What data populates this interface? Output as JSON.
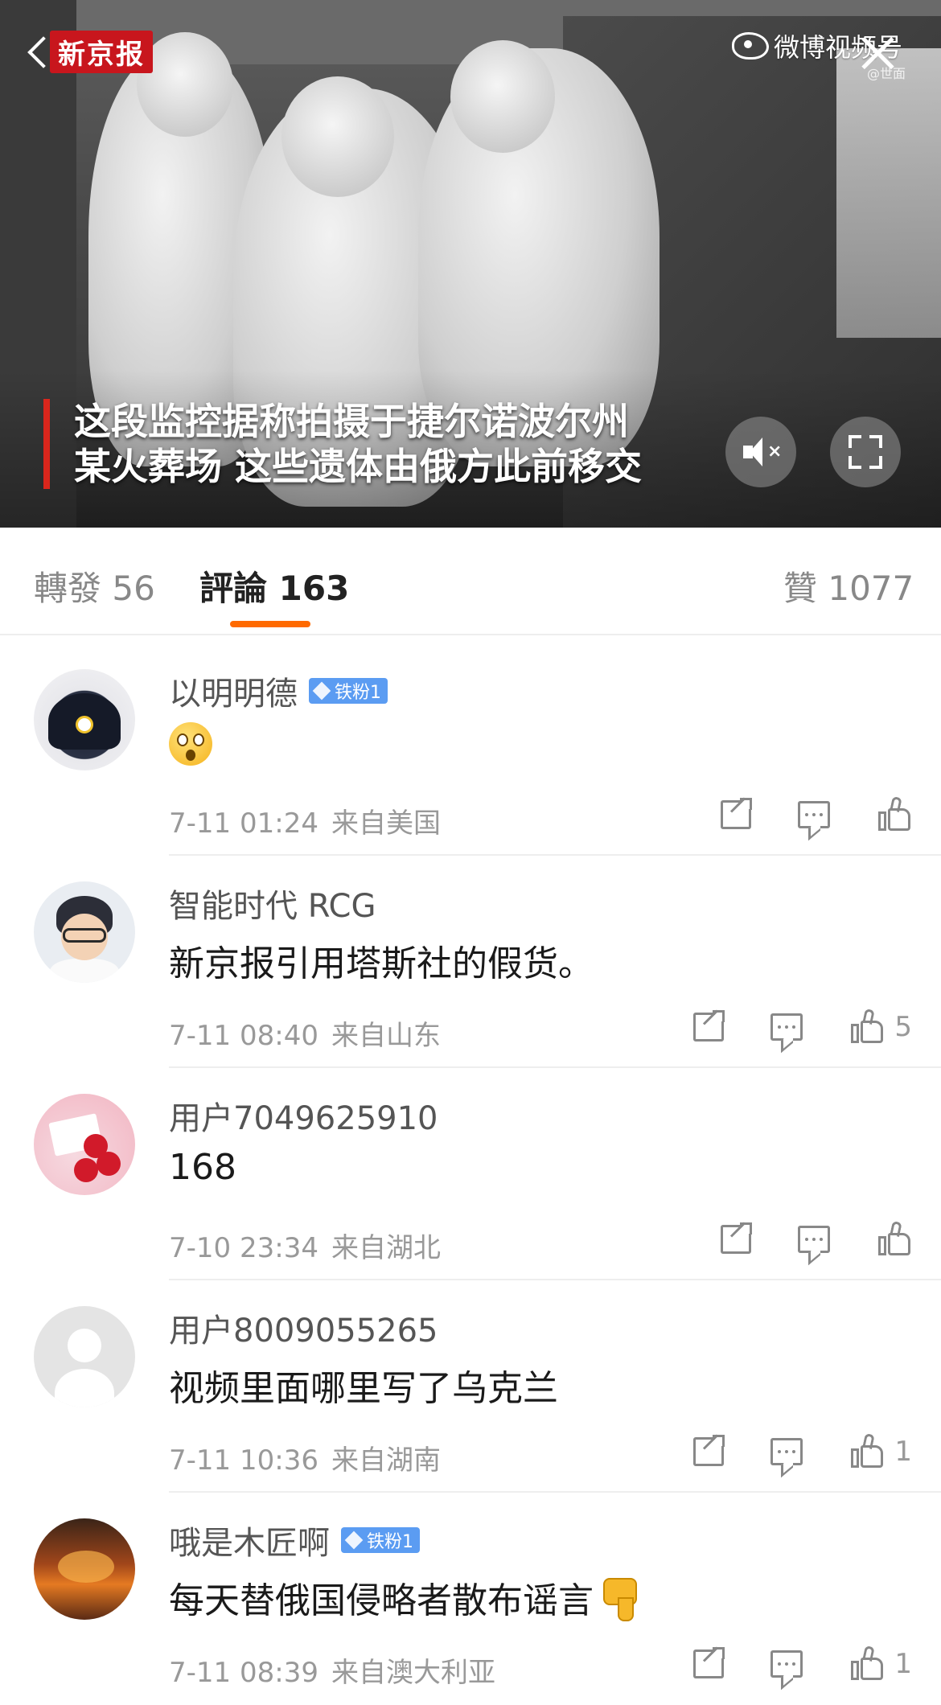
{
  "video": {
    "logo_text": "新京报",
    "platform_text": "微博视频号",
    "watermark_small": "@世面",
    "caption_line1": "这段监控据称拍摄于捷尔诺波尔州",
    "caption_line2": "某火葬场 这些遗体由俄方此前移交",
    "accent_color": "#d9261c"
  },
  "tabs": {
    "repost": "轉發 56",
    "comment": "評論 163",
    "like": "贊 1077",
    "active": "comment",
    "underline_color": "#ff6a00"
  },
  "comments": [
    {
      "username": "以明明德",
      "badge": "铁粉1",
      "text": "",
      "emoji": "astonished-face",
      "time": "7-11 01:24",
      "location": "来自美国",
      "likes": ""
    },
    {
      "username": "智能时代 RCG",
      "badge": "",
      "text": "新京报引用塔斯社的假货。",
      "time": "7-11 08:40",
      "location": "来自山东",
      "likes": "5"
    },
    {
      "username": "用户7049625910",
      "badge": "",
      "text": "168",
      "time": "7-10 23:34",
      "location": "来自湖北",
      "likes": ""
    },
    {
      "username": "用户8009055265",
      "badge": "",
      "text": "视频里面哪里写了乌克兰",
      "time": "7-11 10:36",
      "location": "来自湖南",
      "likes": "1"
    },
    {
      "username": "哦是木匠啊",
      "badge": "铁粉1",
      "text": "每天替俄国侵略者散布谣言",
      "emoji": "thumbs-down",
      "time": "7-11 08:39",
      "location": "来自澳大利亚",
      "likes": "1"
    }
  ],
  "colors": {
    "badge": "#5b9cf2",
    "meta_text": "#999999"
  }
}
